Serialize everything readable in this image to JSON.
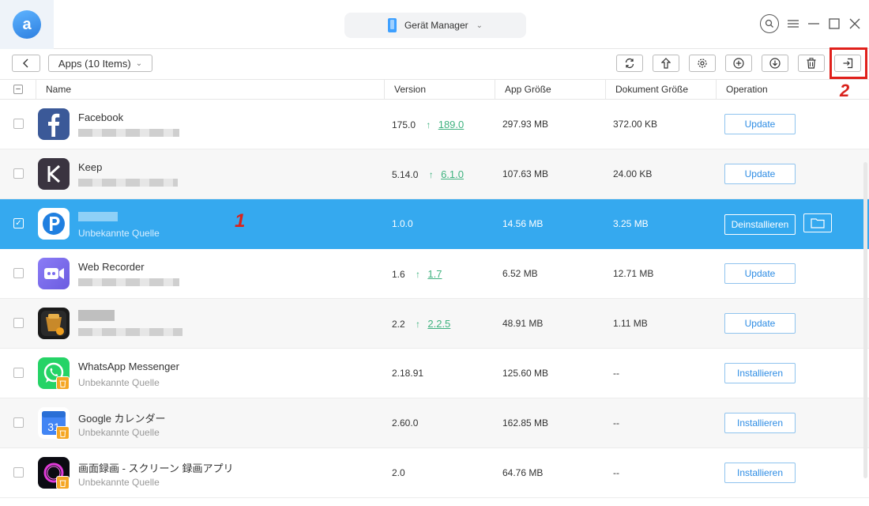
{
  "header": {
    "device_label": "Gerät Manager"
  },
  "toolbar": {
    "apps_label": "Apps (10 Items)"
  },
  "annotations": {
    "marker_1": "1",
    "marker_2": "2"
  },
  "table": {
    "columns": [
      "Name",
      "Version",
      "App Größe",
      "Dokument Größe",
      "Operation"
    ],
    "rows": [
      {
        "name": "Facebook",
        "subtitle": "",
        "version": "175.0",
        "new_version": "189.0",
        "app_size": "297.93 MB",
        "doc_size": "372.00 KB",
        "operation": "Update"
      },
      {
        "name": "Keep",
        "subtitle": "",
        "version": "5.14.0",
        "new_version": "6.1.0",
        "app_size": "107.63 MB",
        "doc_size": "24.00 KB",
        "operation": "Update"
      },
      {
        "name": "",
        "subtitle": "Unbekannte Quelle",
        "version": "1.0.0",
        "new_version": "",
        "app_size": "14.56 MB",
        "doc_size": "3.25 MB",
        "operation": "Deinstallieren"
      },
      {
        "name": "Web Recorder",
        "subtitle": "",
        "version": "1.6",
        "new_version": "1.7",
        "app_size": "6.52 MB",
        "doc_size": "12.71 MB",
        "operation": "Update"
      },
      {
        "name": "",
        "subtitle": "",
        "version": "2.2",
        "new_version": "2.2.5",
        "app_size": "48.91 MB",
        "doc_size": "1.11 MB",
        "operation": "Update"
      },
      {
        "name": "WhatsApp Messenger",
        "subtitle": "Unbekannte Quelle",
        "version": "2.18.91",
        "new_version": "",
        "app_size": "125.60 MB",
        "doc_size": "--",
        "operation": "Installieren"
      },
      {
        "name": "Google カレンダー",
        "subtitle": "Unbekannte Quelle",
        "version": "2.60.0",
        "new_version": "",
        "app_size": "162.85 MB",
        "doc_size": "--",
        "operation": "Installieren"
      },
      {
        "name": "画面録画 - スクリーン 録画アプリ",
        "subtitle": "Unbekannte Quelle",
        "version": "2.0",
        "new_version": "",
        "app_size": "64.76 MB",
        "doc_size": "--",
        "operation": "Installieren"
      }
    ]
  },
  "icons": {
    "calendar_day": "31",
    "logo_letter": "a"
  },
  "colors": {
    "selected_row": "#35a9ef",
    "update_green": "#3fb27f",
    "button_blue": "#2d8ce4",
    "highlight_red": "#e0201b"
  }
}
